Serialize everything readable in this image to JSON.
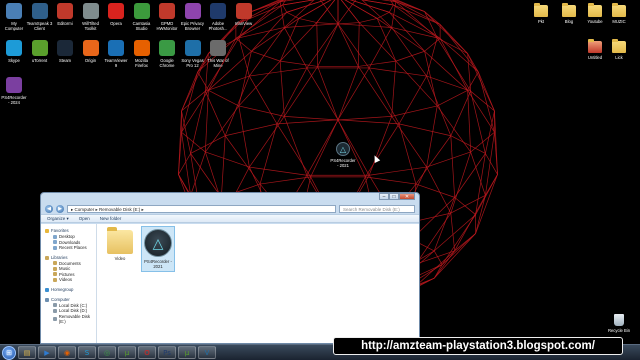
{
  "desktop": {
    "left_icons": [
      {
        "label": "My\nComputer",
        "icon": "computer-icon",
        "color": "#4a7fb5"
      },
      {
        "label": "TeamSpeak 3\nClient",
        "icon": "teamspeak-icon",
        "color": "#2f5f8a"
      },
      {
        "label": "Editormi",
        "icon": "editor-icon",
        "color": "#c0392b"
      },
      {
        "label": "WillTilted\nToolkit",
        "icon": "tools-icon",
        "color": "#7f8c8d"
      },
      {
        "label": "Opera",
        "icon": "opera-icon",
        "color": "#d9231e"
      },
      {
        "label": "Camtasia\nStudio",
        "icon": "camtasia-icon",
        "color": "#3c9a3c"
      },
      {
        "label": "GPMD\nHWMonitor",
        "icon": "monitor-icon",
        "color": "#c0392b"
      },
      {
        "label": "Epic Privacy\nBrowser",
        "icon": "epic-icon",
        "color": "#8e44ad"
      },
      {
        "label": "Adobe\nPhotosh...",
        "icon": "photoshop-icon",
        "color": "#1f3a6b"
      },
      {
        "label": "IrfanView",
        "icon": "irfanview-icon",
        "color": "#c0392b"
      },
      {
        "label": "Skype",
        "icon": "skype-icon",
        "color": "#1d9bd7"
      },
      {
        "label": "uTorrent",
        "icon": "utorrent-icon",
        "color": "#5aa02c"
      },
      {
        "label": "Steam",
        "icon": "steam-icon",
        "color": "#1b2838"
      },
      {
        "label": "Origin",
        "icon": "origin-icon",
        "color": "#e8661a"
      },
      {
        "label": "TeamViewer\n9",
        "icon": "teamviewer-icon",
        "color": "#1a6fb5"
      },
      {
        "label": "Mozilla\nFirefox",
        "icon": "firefox-icon",
        "color": "#e66000"
      },
      {
        "label": "Google\nChrome",
        "icon": "chrome-icon",
        "color": "#3a9a44"
      },
      {
        "label": "Sony Vegas\nPro 12",
        "icon": "vegas-icon",
        "color": "#1e6fa8"
      },
      {
        "label": "This War of\nMine",
        "icon": "game-icon",
        "color": "#6b6b6b"
      },
      {
        "label": "PS4Recorder\n- 2024",
        "icon": "winrar-icon",
        "color": "#7b3fa0"
      }
    ],
    "right_icons": [
      {
        "label": "Pkt",
        "icon": "folder-icon"
      },
      {
        "label": "Blog",
        "icon": "folder-icon"
      },
      {
        "label": "Youtube",
        "icon": "folder-icon"
      },
      {
        "label": "MUZIC",
        "icon": "folder-icon"
      },
      {
        "label": "Untitled",
        "icon": "image-icon"
      },
      {
        "label": "Lick",
        "icon": "folder-icon"
      }
    ],
    "center_icon": {
      "label": "PS4Recorder\n- 2021",
      "glyph": "△"
    },
    "recycle_bin": {
      "label": "Recycle Bin"
    },
    "sphere_color": "#c0191e"
  },
  "explorer": {
    "address": "▸ Computer ▸ Removable Disk (E:) ▸",
    "search_placeholder": "Search Removable Disk (E:)",
    "toolbar": {
      "organize": "Organize ▾",
      "open": "Open",
      "new_folder": "New folder"
    },
    "nav": {
      "favorites": "Favorites",
      "favorites_items": [
        "Desktop",
        "Downloads",
        "Recent Places"
      ],
      "libraries": "Libraries",
      "libraries_items": [
        "Documents",
        "Music",
        "Pictures",
        "Videos"
      ],
      "homegroup": "Homegroup",
      "computer": "Computer",
      "computer_items": [
        "Local Disk (C:)",
        "Local Disk (D:)",
        "Removable Disk (E:)"
      ]
    },
    "files": [
      {
        "label": "Video",
        "type": "folder"
      },
      {
        "label": "PS4Recorder -\n2021",
        "type": "app"
      }
    ],
    "controls": {
      "min": "–",
      "max": "□",
      "close": "✕"
    }
  },
  "taskbar": {
    "start_glyph": "⊞",
    "items": [
      {
        "icon": "explorer-icon",
        "glyph": "▤",
        "color": "#e2b94a"
      },
      {
        "icon": "media-player-icon",
        "glyph": "▶",
        "color": "#2e7bd1"
      },
      {
        "icon": "firefox-icon",
        "glyph": "◉",
        "color": "#e66000"
      },
      {
        "icon": "skype-icon",
        "glyph": "S",
        "color": "#1d9bd7"
      },
      {
        "icon": "chrome-icon",
        "glyph": "◎",
        "color": "#3a9a44"
      },
      {
        "icon": "utorrent-icon",
        "glyph": "µ",
        "color": "#5aa02c"
      },
      {
        "icon": "opera-icon",
        "glyph": "O",
        "color": "#d9231e"
      },
      {
        "icon": "photoshop-icon",
        "glyph": "Ps",
        "color": "#1f3a6b"
      },
      {
        "icon": "utorrent2-icon",
        "glyph": "µ",
        "color": "#5aa02c"
      },
      {
        "icon": "vegas-icon",
        "glyph": "V",
        "color": "#1e6fa8"
      }
    ]
  },
  "banner": {
    "url": "http://amzteam-playstation3.blogspot.com/"
  }
}
